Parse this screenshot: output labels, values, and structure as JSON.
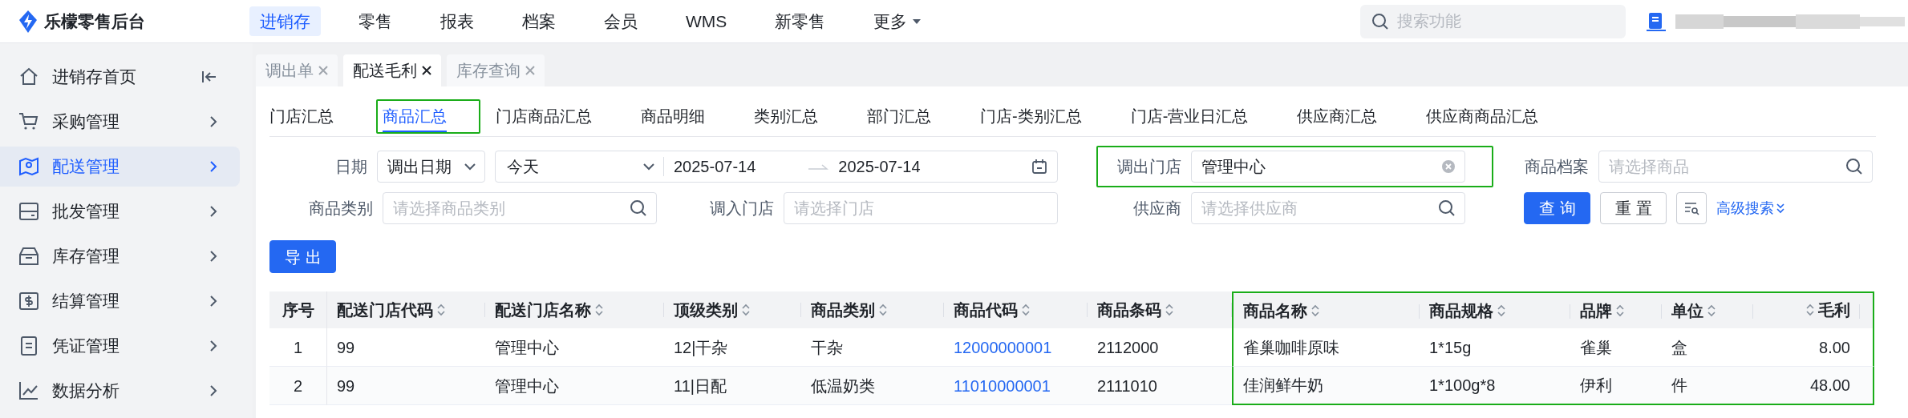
{
  "app": {
    "title": "乐檬零售后台"
  },
  "top_nav": [
    {
      "label": "进销存",
      "selected": true
    },
    {
      "label": "零售",
      "selected": false
    },
    {
      "label": "报表",
      "selected": false
    },
    {
      "label": "档案",
      "selected": false
    },
    {
      "label": "会员",
      "selected": false
    },
    {
      "label": "WMS",
      "selected": false
    },
    {
      "label": "新零售",
      "selected": false
    },
    {
      "label": "更多",
      "selected": false,
      "kind": "dropdown"
    }
  ],
  "search": {
    "placeholder": "搜索功能"
  },
  "sidebar": {
    "items": [
      {
        "label": "进销存首页",
        "selected": false,
        "kind": "home"
      },
      {
        "label": "采购管理",
        "selected": false,
        "kind": "menu"
      },
      {
        "label": "配送管理",
        "selected": true,
        "kind": "menu"
      },
      {
        "label": "批发管理",
        "selected": false,
        "kind": "menu"
      },
      {
        "label": "库存管理",
        "selected": false,
        "kind": "menu"
      },
      {
        "label": "结算管理",
        "selected": false,
        "kind": "menu"
      },
      {
        "label": "凭证管理",
        "selected": false,
        "kind": "menu"
      },
      {
        "label": "数据分析",
        "selected": false,
        "kind": "menu"
      }
    ]
  },
  "page_tabs": [
    {
      "label": "调出单",
      "selected": false
    },
    {
      "label": "配送毛利",
      "selected": true
    },
    {
      "label": "库存查询",
      "selected": false
    }
  ],
  "report_tabs": [
    {
      "label": "门店汇总",
      "selected": false,
      "highlighted": false
    },
    {
      "label": "商品汇总",
      "selected": true,
      "highlighted": true
    },
    {
      "label": "门店商品汇总",
      "selected": false,
      "highlighted": false
    },
    {
      "label": "商品明细",
      "selected": false,
      "highlighted": false
    },
    {
      "label": "类别汇总",
      "selected": false,
      "highlighted": false
    },
    {
      "label": "部门汇总",
      "selected": false,
      "highlighted": false
    },
    {
      "label": "门店-类别汇总",
      "selected": false,
      "highlighted": false
    },
    {
      "label": "门店-营业日汇总",
      "selected": false,
      "highlighted": false
    },
    {
      "label": "供应商汇总",
      "selected": false,
      "highlighted": false
    },
    {
      "label": "供应商商品汇总",
      "selected": false,
      "highlighted": false
    }
  ],
  "filters": [
    {
      "label": "日期",
      "kind": "date_range",
      "mode": "调出日期",
      "preset": "今天",
      "start": "2025-07-14",
      "end": "2025-07-14",
      "highlighted": false
    },
    {
      "label": "调出门店",
      "kind": "select",
      "value": "管理中心",
      "highlighted": true
    },
    {
      "label": "商品档案",
      "kind": "search",
      "placeholder": "请选择商品",
      "highlighted": false
    },
    {
      "label": "商品类别",
      "kind": "search",
      "placeholder": "请选择商品类别",
      "highlighted": false
    },
    {
      "label": "调入门店",
      "kind": "select",
      "placeholder": "请选择门店",
      "highlighted": false
    },
    {
      "label": "供应商",
      "kind": "search",
      "placeholder": "请选择供应商",
      "highlighted": false
    }
  ],
  "actions": [
    {
      "label": "查询",
      "kind": "primary"
    },
    {
      "label": "重置",
      "kind": "default"
    },
    {
      "kind": "icon"
    },
    {
      "label": "高级搜索",
      "kind": "link"
    }
  ],
  "export_button": {
    "label": "导出"
  },
  "table": {
    "columns": [
      {
        "label": "序号",
        "sortable": false,
        "kind": "index",
        "highlighted": false
      },
      {
        "label": "配送门店代码",
        "sortable": true,
        "kind": "text",
        "highlighted": false
      },
      {
        "label": "配送门店名称",
        "sortable": true,
        "kind": "text",
        "highlighted": false
      },
      {
        "label": "顶级类别",
        "sortable": true,
        "kind": "text",
        "highlighted": false
      },
      {
        "label": "商品类别",
        "sortable": true,
        "kind": "text",
        "highlighted": false
      },
      {
        "label": "商品代码",
        "sortable": true,
        "kind": "link",
        "highlighted": false
      },
      {
        "label": "商品条码",
        "sortable": true,
        "kind": "text",
        "highlighted": false
      },
      {
        "label": "商品名称",
        "sortable": true,
        "kind": "text",
        "highlighted": true
      },
      {
        "label": "商品规格",
        "sortable": true,
        "kind": "text",
        "highlighted": true
      },
      {
        "label": "品牌",
        "sortable": true,
        "kind": "text",
        "highlighted": true
      },
      {
        "label": "单位",
        "sortable": true,
        "kind": "text",
        "highlighted": true
      },
      {
        "label": "毛利",
        "sortable": true,
        "kind": "number",
        "highlighted": true
      }
    ],
    "rows": [
      {
        "cells": [
          "1",
          "99",
          "管理中心",
          "12|干杂",
          "干杂",
          "12000000001",
          "2112000",
          "雀巢咖啡原味",
          "1*15g",
          "雀巢",
          "盒",
          "8.00"
        ]
      },
      {
        "cells": [
          "2",
          "99",
          "管理中心",
          "11|日配",
          "低温奶类",
          "11010000001",
          "2111010",
          "佳润鲜牛奶",
          "1*100g*8",
          "伊利",
          "件",
          "48.00"
        ]
      }
    ]
  }
}
